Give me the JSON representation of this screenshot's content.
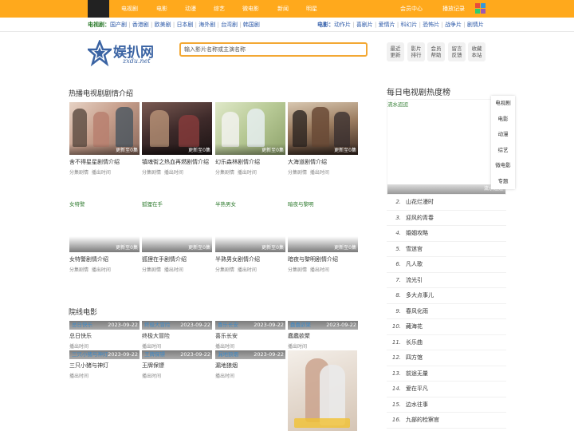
{
  "top_nav": {
    "items": [
      "电视剧",
      "电影",
      "动漫",
      "综艺",
      "微电影",
      "新闻",
      "明星"
    ],
    "member_center": "会员中心",
    "history": "播放记录"
  },
  "sub_nav": {
    "tv_label": "电视剧：",
    "tv_items": [
      "国产剧",
      "香港剧",
      "欧美剧",
      "日本剧",
      "海外剧",
      "台湾剧",
      "韩国剧"
    ],
    "movie_label": "电影：",
    "movie_items": [
      "动作片",
      "喜剧片",
      "爱情片",
      "科幻片",
      "恐怖片",
      "战争片",
      "剧情片"
    ]
  },
  "logo": {
    "name": "娱扒网",
    "domain": "zxdu.net"
  },
  "search": {
    "placeholder": "输入影片名称或主演名称"
  },
  "quick_buttons": [
    {
      "line1": "最近",
      "line2": "更新"
    },
    {
      "line1": "影片",
      "line2": "排行"
    },
    {
      "line1": "会员",
      "line2": "帮助"
    },
    {
      "line1": "留言",
      "line2": "反馈"
    },
    {
      "line1": "收藏",
      "line2": "本站"
    }
  ],
  "hot_tv": {
    "title": "热播电视剧剧情介绍",
    "row1": [
      {
        "title": "舍不得星星剧情介绍",
        "badge": "更新至0集",
        "meta1": "分集剧情",
        "meta2": "播出时间"
      },
      {
        "title": "镇魂街之热血再燃剧情介绍",
        "badge": "更新至0集",
        "meta1": "分集剧情",
        "meta2": "播出时间"
      },
      {
        "title": "幻乐森林剧情介绍",
        "badge": "更新至0集",
        "meta1": "分集剧情",
        "meta2": "播出时间"
      },
      {
        "title": "大海道剧情介绍",
        "badge": "更新至0集",
        "meta1": "分集剧情",
        "meta2": "播出时间"
      }
    ],
    "row2": [
      {
        "alt": "女特警",
        "title": "女特警剧情介绍",
        "badge": "更新至0集",
        "meta1": "分集剧情",
        "meta2": "播出时间"
      },
      {
        "alt": "狐狸在手",
        "title": "狐狸在手剧情介绍",
        "badge": "更新至0集",
        "meta1": "分集剧情",
        "meta2": "播出时间"
      },
      {
        "alt": "半熟男女",
        "title": "半熟男女剧情介绍",
        "badge": "更新至0集",
        "meta1": "分集剧情",
        "meta2": "播出时间"
      },
      {
        "alt": "暗夜与黎明",
        "title": "暗夜与黎明剧情介绍",
        "badge": "更新至0集",
        "meta1": "分集剧情",
        "meta2": "播出时间"
      }
    ]
  },
  "cinema": {
    "title": "院线电影",
    "items": [
      {
        "alt": "总日快乐",
        "date": "2023-09-22",
        "title": "总日快乐",
        "time": "播出时间"
      },
      {
        "alt": "终极大冒险",
        "date": "2023-09-22",
        "title": "终极大冒险",
        "time": "播出时间"
      },
      {
        "alt": "喜乐长安",
        "date": "2023-09-22",
        "title": "喜乐长安",
        "time": "播出时间"
      },
      {
        "alt": "蠢蠢欲聚",
        "date": "2023-09-22",
        "title": "蠢蠢欲聚",
        "time": "播出时间"
      },
      {
        "alt": "三只小猪与神灯",
        "date": "2023-09-22",
        "title": "三只小猪与神灯",
        "time": "播出时间"
      },
      {
        "alt": "王牌保镖",
        "date": "2023-09-22",
        "title": "王牌保镖",
        "time": "播出时间"
      },
      {
        "alt": "漏地狼烟",
        "date": "2023-09-22",
        "title": "漏地狼烟",
        "time": "播出时间"
      }
    ]
  },
  "ranking": {
    "title": "每日电视剧热度榜",
    "top_alt": "流水迢迢",
    "top_caption": "流水迢迢",
    "items": [
      {
        "n": "2.",
        "title": "山花烂漫时"
      },
      {
        "n": "3.",
        "title": "迎风的青春"
      },
      {
        "n": "4.",
        "title": "婚姻攻略"
      },
      {
        "n": "5.",
        "title": "雪迷宫"
      },
      {
        "n": "6.",
        "title": "凡人歌"
      },
      {
        "n": "7.",
        "title": "流光引"
      },
      {
        "n": "8.",
        "title": "多大点事儿"
      },
      {
        "n": "9.",
        "title": "春风化雨"
      },
      {
        "n": "10.",
        "title": "藏海花"
      },
      {
        "n": "11.",
        "title": "长乐曲"
      },
      {
        "n": "12.",
        "title": "四方馆"
      },
      {
        "n": "13.",
        "title": "前途无量"
      },
      {
        "n": "14.",
        "title": "爱在平凡"
      },
      {
        "n": "15.",
        "title": "边水往事"
      },
      {
        "n": "16.",
        "title": "九部的检察官"
      }
    ]
  },
  "side_tabs": [
    "电视剧",
    "电影",
    "动漫",
    "综艺",
    "微电影",
    "专题"
  ]
}
